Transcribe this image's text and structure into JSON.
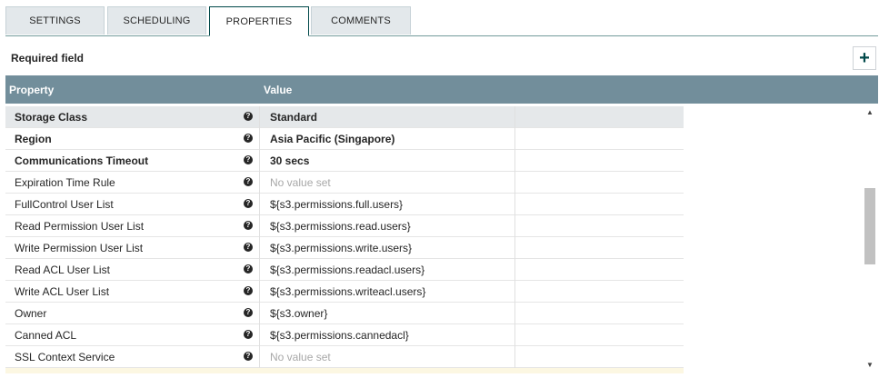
{
  "tabs": [
    "SETTINGS",
    "SCHEDULING",
    "PROPERTIES",
    "COMMENTS"
  ],
  "active_tab": "PROPERTIES",
  "required_label": "Required field",
  "add_button": "+",
  "table": {
    "headers": {
      "property": "Property",
      "value": "Value"
    },
    "rows": [
      {
        "name": "Storage Class",
        "value": "Standard",
        "required": true,
        "unset": false
      },
      {
        "name": "Region",
        "value": "Asia Pacific (Singapore)",
        "required": true,
        "unset": false
      },
      {
        "name": "Communications Timeout",
        "value": "30 secs",
        "required": true,
        "unset": false
      },
      {
        "name": "Expiration Time Rule",
        "value": "No value set",
        "required": false,
        "unset": true
      },
      {
        "name": "FullControl User List",
        "value": "${s3.permissions.full.users}",
        "required": false,
        "unset": false
      },
      {
        "name": "Read Permission User List",
        "value": "${s3.permissions.read.users}",
        "required": false,
        "unset": false
      },
      {
        "name": "Write Permission User List",
        "value": "${s3.permissions.write.users}",
        "required": false,
        "unset": false
      },
      {
        "name": "Read ACL User List",
        "value": "${s3.permissions.readacl.users}",
        "required": false,
        "unset": false
      },
      {
        "name": "Write ACL User List",
        "value": "${s3.permissions.writeacl.users}",
        "required": false,
        "unset": false
      },
      {
        "name": "Owner",
        "value": "${s3.owner}",
        "required": false,
        "unset": false
      },
      {
        "name": "Canned ACL",
        "value": "${s3.permissions.cannedacl}",
        "required": false,
        "unset": false
      },
      {
        "name": "SSL Context Service",
        "value": "No value set",
        "required": false,
        "unset": true
      }
    ]
  },
  "help_glyph": "?",
  "scroll_glyphs": {
    "up": "▲",
    "down": "▼"
  }
}
